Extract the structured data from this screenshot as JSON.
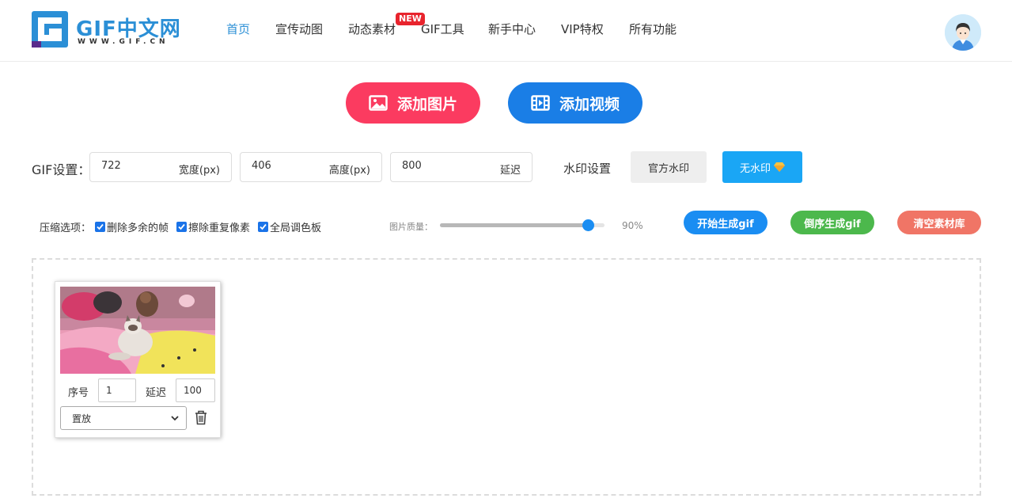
{
  "logo": {
    "text": "GIF中文网",
    "subtext": "WWW.GIF.CN"
  },
  "nav": {
    "items": [
      {
        "label": "首页",
        "active": true
      },
      {
        "label": "宣传动图"
      },
      {
        "label": "动态素材"
      },
      {
        "label": "GIF工具"
      },
      {
        "label": "新手中心"
      },
      {
        "label": "VIP特权"
      },
      {
        "label": "所有功能"
      }
    ],
    "new_badge": "NEW"
  },
  "actions": {
    "add_image": "添加图片",
    "add_video": "添加视频"
  },
  "gif_settings": {
    "label": "GIF设置：",
    "width": {
      "value": "722",
      "unit": "宽度(px)"
    },
    "height": {
      "value": "406",
      "unit": "高度(px)"
    },
    "delay": {
      "value": "800",
      "unit": "延迟"
    },
    "watermark_label": "水印设置",
    "watermark_official": "官方水印",
    "watermark_none": "无水印"
  },
  "compression": {
    "label": "压缩选项：",
    "options": [
      {
        "label": "删除多余的帧",
        "checked": true
      },
      {
        "label": "擦除重复像素",
        "checked": true
      },
      {
        "label": "全局调色板",
        "checked": true
      }
    ],
    "quality_label": "图片质量：",
    "quality_value": "90%",
    "quality_percent": 90
  },
  "generate": {
    "start": "开始生成gif",
    "reverse": "倒序生成gif",
    "clear": "清空素材库"
  },
  "material_card": {
    "order_label": "序号",
    "order_value": "1",
    "delay_label": "延迟",
    "delay_value": "100",
    "select_value": "置放"
  },
  "colors": {
    "accent": "#2b8fd6",
    "add_image": "#fb3b60",
    "add_video": "#1a7ee6",
    "start": "#1a8df2",
    "reverse": "#4cb84c",
    "clear": "#f07566"
  }
}
